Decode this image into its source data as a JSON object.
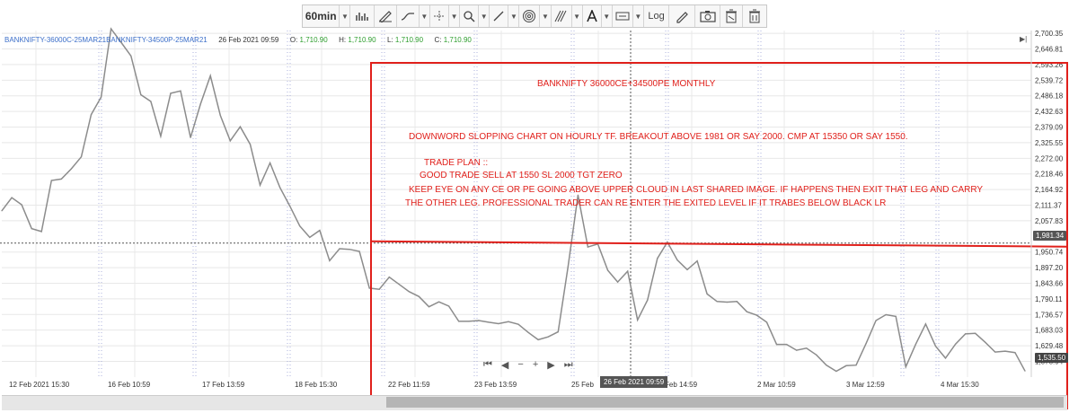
{
  "toolbar": {
    "interval": "60min",
    "log_label": "Log"
  },
  "info": {
    "symbol": "BANKNIFTY-36000C-25MAR21BANKNIFTY-34500P-25MAR21",
    "datetime": "26 Feb 2021 09:59",
    "o_label": "O:",
    "o_val": "1,710.90",
    "h_label": "H:",
    "h_val": "1,710.90",
    "l_label": "L:",
    "l_val": "1,710.90",
    "c_label": "C:",
    "c_val": "1,710.90"
  },
  "annotations": {
    "title": "BANKNIFTY 36000CE+34500PE MONTHLY",
    "line1": "DOWNWORD SLOPPING CHART ON HOURLY TF. BREAKOUT ABOVE 1981 OR SAY 2000. CMP AT 15350 OR SAY 1550.",
    "line2": "TRADE PLAN ::",
    "line3": "GOOD TRADE SELL AT 1550 SL 2000 TGT ZERO",
    "line4": "KEEP EYE ON ANY CE OR PE GOING ABOVE UPPER CLOUD IN LAST SHARED IMAGE. IF HAPPENS THEN EXIT THAT LEG AND CARRY",
    "line5": "THE OTHER LEG. PROFESSIONAL TRADER CAN RE ENTER THE EXITED LEVEL IF IT TRABES BELOW BLACK LR"
  },
  "price_labels": {
    "level": "1,981.34",
    "last": "1,535.50",
    "crosshair_time": "26 Feb 2021 09:59"
  },
  "colors": {
    "price_line": "#8c8c8c",
    "annotation": "#e0201b",
    "grid": "#e8e8e8",
    "session": "#9aa0d6"
  },
  "chart_data": {
    "type": "line",
    "title": "",
    "xlabel": "",
    "ylabel": "",
    "ylim": [
      1522.0,
      2710.0
    ],
    "y_ticks": [
      2700.35,
      2646.81,
      2593.26,
      2539.72,
      2486.18,
      2432.63,
      2379.09,
      2325.55,
      2272.0,
      2218.46,
      2164.92,
      2111.37,
      2057.83,
      1950.74,
      1897.2,
      1843.66,
      1790.11,
      1736.57,
      1683.03,
      1629.48,
      1575.94
    ],
    "x_ticks": [
      "12 Feb 2021 15:30",
      "16 Feb 10:59",
      "17 Feb 13:59",
      "18 Feb 15:30",
      "22 Feb 11:59",
      "23 Feb 13:59",
      "25 Feb",
      "Feb 14:59",
      "2 Mar 10:59",
      "3 Mar 12:59",
      "4 Mar 15:30"
    ],
    "series": [
      {
        "values": [
          2092,
          2137,
          2113,
          2031,
          2021,
          2196,
          2201,
          2236,
          2277,
          2422,
          2482,
          2716,
          2670,
          2623,
          2490,
          2467,
          2348,
          2495,
          2503,
          2343,
          2458,
          2555,
          2419,
          2332,
          2380,
          2320,
          2180,
          2256,
          2172,
          2108,
          2040,
          2001,
          2025,
          1921,
          1962,
          1960,
          1953,
          1827,
          1823,
          1865,
          1840,
          1815,
          1798,
          1763,
          1780,
          1765,
          1713,
          1713,
          1716,
          1710,
          1705,
          1712,
          1703,
          1675,
          1650,
          1660,
          1677,
          1900,
          2146,
          1968,
          1978,
          1888,
          1848,
          1885,
          1718,
          1786,
          1929,
          1985,
          1923,
          1890,
          1920,
          1807,
          1781,
          1779,
          1781,
          1746,
          1734,
          1710,
          1634,
          1634,
          1614,
          1621,
          1598,
          1563,
          1542,
          1561,
          1563,
          1637,
          1716,
          1736,
          1730,
          1557,
          1635,
          1704,
          1628,
          1587,
          1635,
          1670,
          1672,
          1641,
          1608,
          1611,
          1606,
          1543
        ]
      }
    ],
    "horizontal_level": 1981.34,
    "last_value": 1535.5,
    "crosshair_x_label": "26 Feb 2021 09:59"
  }
}
